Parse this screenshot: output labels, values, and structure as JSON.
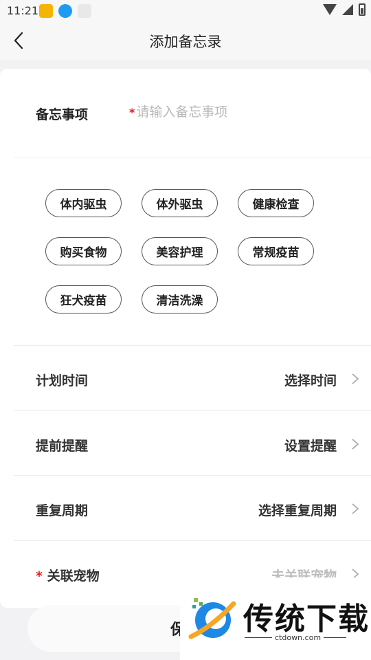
{
  "status_bar": {
    "time": "11:21"
  },
  "nav": {
    "title": "添加备忘录",
    "back_icon": "chevron-left-icon"
  },
  "memo": {
    "label": "备忘事项",
    "required_mark": "*",
    "placeholder": "请输入备忘事项",
    "value": ""
  },
  "tags": [
    "体内驱虫",
    "体外驱虫",
    "健康检查",
    "购买食物",
    "美容护理",
    "常规疫苗",
    "狂犬疫苗",
    "清洁洗澡"
  ],
  "options": [
    {
      "label": "计划时间",
      "value": "选择时间"
    },
    {
      "label": "提前提醒",
      "value": "设置提醒"
    },
    {
      "label": "重复周期",
      "value": "选择重复周期"
    },
    {
      "label": "关联宠物",
      "required_mark": "*",
      "value": "未关联宠物"
    }
  ],
  "save": {
    "label": "保存"
  },
  "watermark": {
    "brand": "传统下载",
    "url": "ctdown.com"
  },
  "colors": {
    "required": "#e02020",
    "placeholder": "#b8b8b8",
    "tag_border": "#555555"
  }
}
